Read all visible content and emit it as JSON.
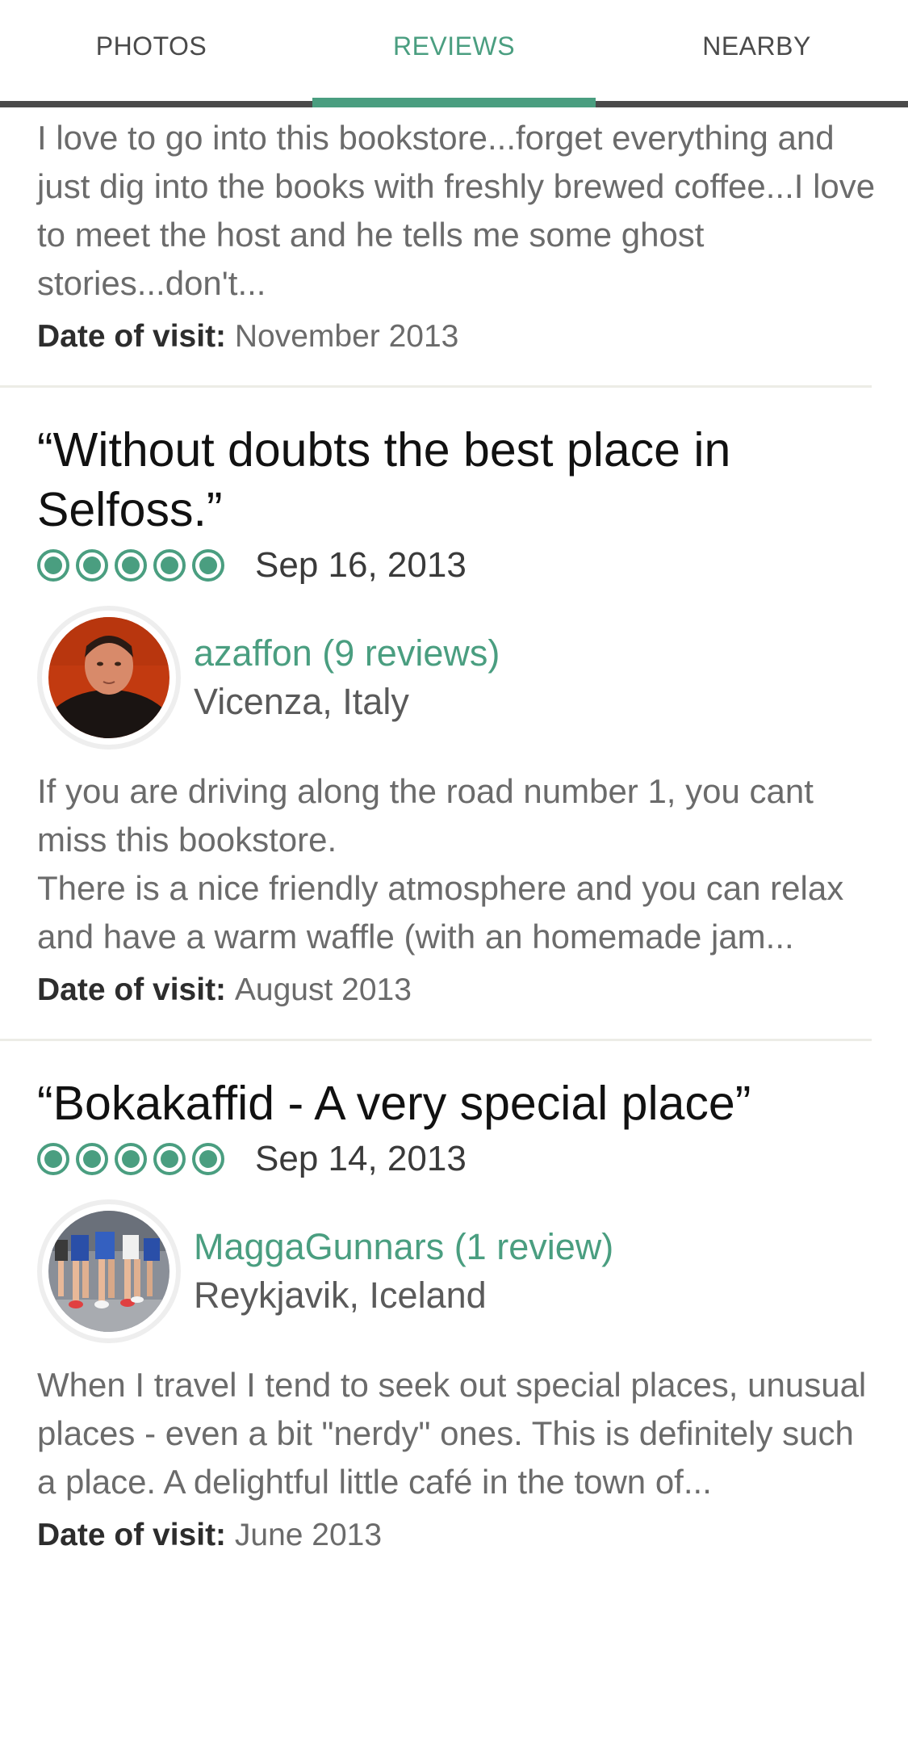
{
  "tabs": {
    "photos": "PHOTOS",
    "reviews": "REVIEWS",
    "nearby": "NEARBY",
    "active": "REVIEWS"
  },
  "colors": {
    "accent": "#4a9e80",
    "tab_bar_border": "#4a4a4a",
    "body_text": "#6b6b6b"
  },
  "visit_label": "Date of visit:",
  "reviews": [
    {
      "body": "I love to go into this bookstore...forget everything and just dig into the books with freshly brewed coffee...I love to meet the host and he tells me some ghost stories...don't...",
      "visit_date": "November 2013"
    },
    {
      "title": "“Without doubts the best place in Selfoss.”",
      "rating": 5,
      "date": "Sep 16, 2013",
      "reviewer": "azaffon (9 reviews)",
      "location": "Vicenza, Italy",
      "body_lines": [
        "If you are driving along the road number 1, you cant miss this bookstore.",
        "There is a nice friendly atmosphere and you can relax and have a warm waffle (with an homemade jam..."
      ],
      "visit_date": "August 2013"
    },
    {
      "title": "“Bokakaffid - A very special place”",
      "rating": 5,
      "date": "Sep 14, 2013",
      "reviewer": "MaggaGunnars (1 review)",
      "location": "Reykjavik, Iceland",
      "body": "When I travel I tend to seek out special places, unusual places - even a bit \"nerdy\" ones. This is definitely such a place. A delightful little café in the town of...",
      "visit_date": "June 2013"
    }
  ]
}
